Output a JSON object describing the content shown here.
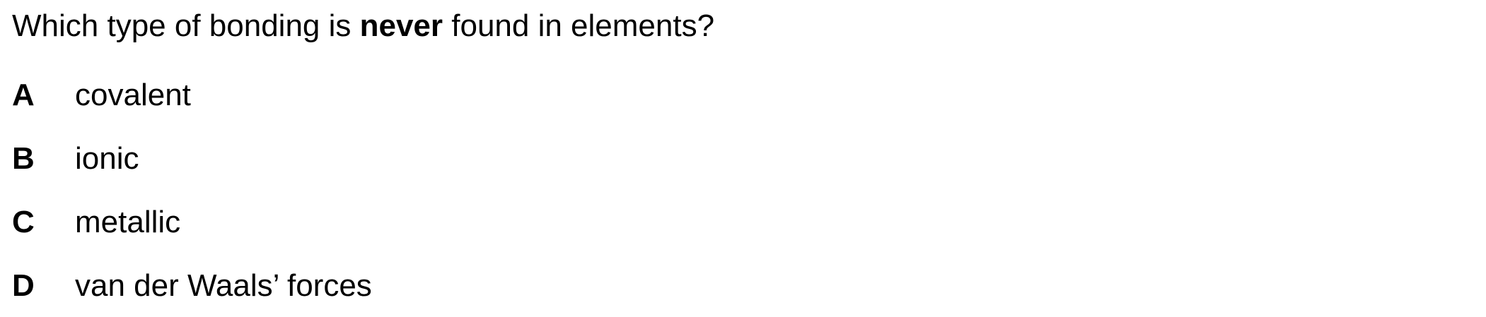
{
  "question": {
    "before": "Which type of bonding is ",
    "emphasis": "never",
    "after": " found in elements?"
  },
  "options": [
    {
      "letter": "A",
      "text": "covalent"
    },
    {
      "letter": "B",
      "text": "ionic"
    },
    {
      "letter": "C",
      "text": "metallic"
    },
    {
      "letter": "D",
      "text": "van der Waals’ forces"
    }
  ]
}
